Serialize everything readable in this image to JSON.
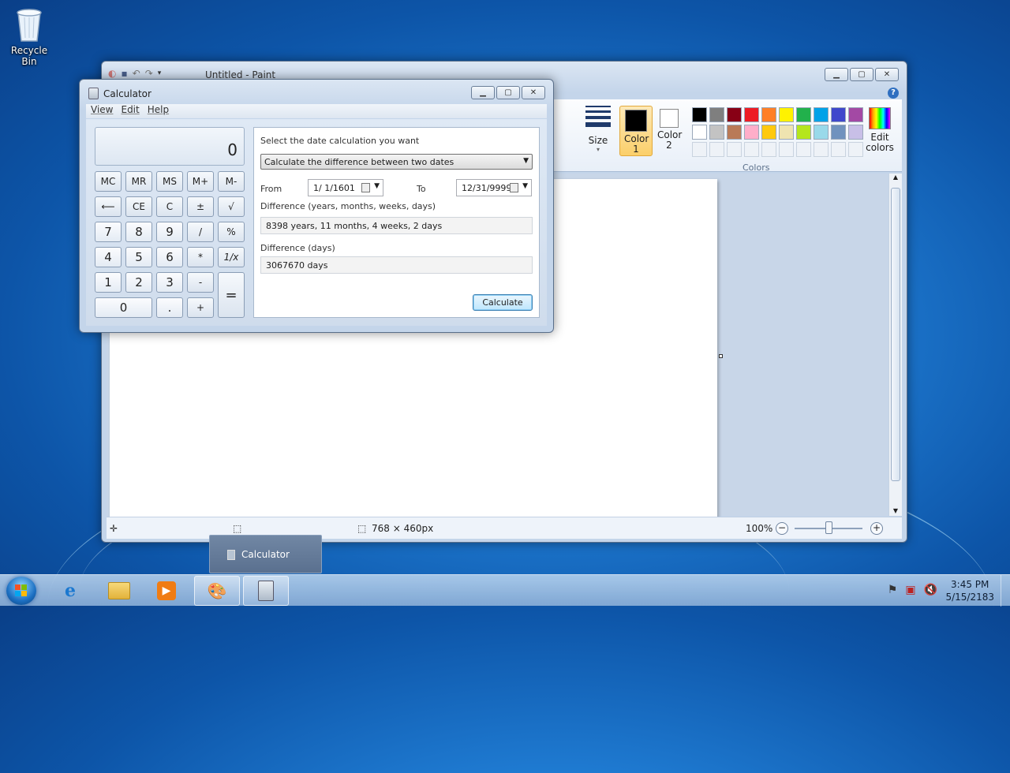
{
  "desktop": {
    "recycle_bin_label": "Recycle Bin"
  },
  "paint": {
    "title": "Untitled - Paint",
    "ribbon": {
      "size_label": "Size",
      "color1_label": "Color 1",
      "color2_label": "Color 2",
      "colors_group_label": "Colors",
      "edit_colors_label": "Edit colors",
      "color1": "#000000",
      "color2": "#ffffff",
      "palette": [
        "#000000",
        "#7f7f7f",
        "#880015",
        "#ed1c24",
        "#ff7f27",
        "#fff200",
        "#22b14c",
        "#00a2e8",
        "#3f48cc",
        "#a349a4",
        "#ffffff",
        "#c3c3c3",
        "#b97a57",
        "#ffaec9",
        "#ffc90e",
        "#efe4b0",
        "#b5e61d",
        "#99d9ea",
        "#7092be",
        "#c8bfe7"
      ]
    },
    "status": {
      "dimensions": "768 × 460px",
      "zoom": "100%"
    }
  },
  "calculator": {
    "title": "Calculator",
    "menu": [
      "View",
      "Edit",
      "Help"
    ],
    "display": "0",
    "keys": {
      "mc": "MC",
      "mr": "MR",
      "ms": "MS",
      "mplus": "M+",
      "mminus": "M-",
      "back": "⟵",
      "ce": "CE",
      "c": "C",
      "pm": "±",
      "sqrt": "√",
      "k7": "7",
      "k8": "8",
      "k9": "9",
      "div": "/",
      "pct": "%",
      "k4": "4",
      "k5": "5",
      "k6": "6",
      "mul": "*",
      "inv": "1/x",
      "k1": "1",
      "k2": "2",
      "k3": "3",
      "sub": "-",
      "eq": "=",
      "k0": "0",
      "dot": ".",
      "add": "+"
    },
    "date_calc": {
      "prompt": "Select the date calculation you want",
      "mode": "Calculate the difference between two dates",
      "from_label": "From",
      "from_value": "1/  1/1601",
      "to_label": "To",
      "to_value": "12/31/9999",
      "diff_ymwd_label": "Difference (years, months, weeks, days)",
      "diff_ymwd_value": "8398 years, 11 months, 4 weeks, 2 days",
      "diff_days_label": "Difference (days)",
      "diff_days_value": "3067670 days",
      "calculate_button": "Calculate"
    }
  },
  "taskbar": {
    "popup_label": "Calculator",
    "time": "3:45 PM",
    "date": "5/15/2183"
  }
}
